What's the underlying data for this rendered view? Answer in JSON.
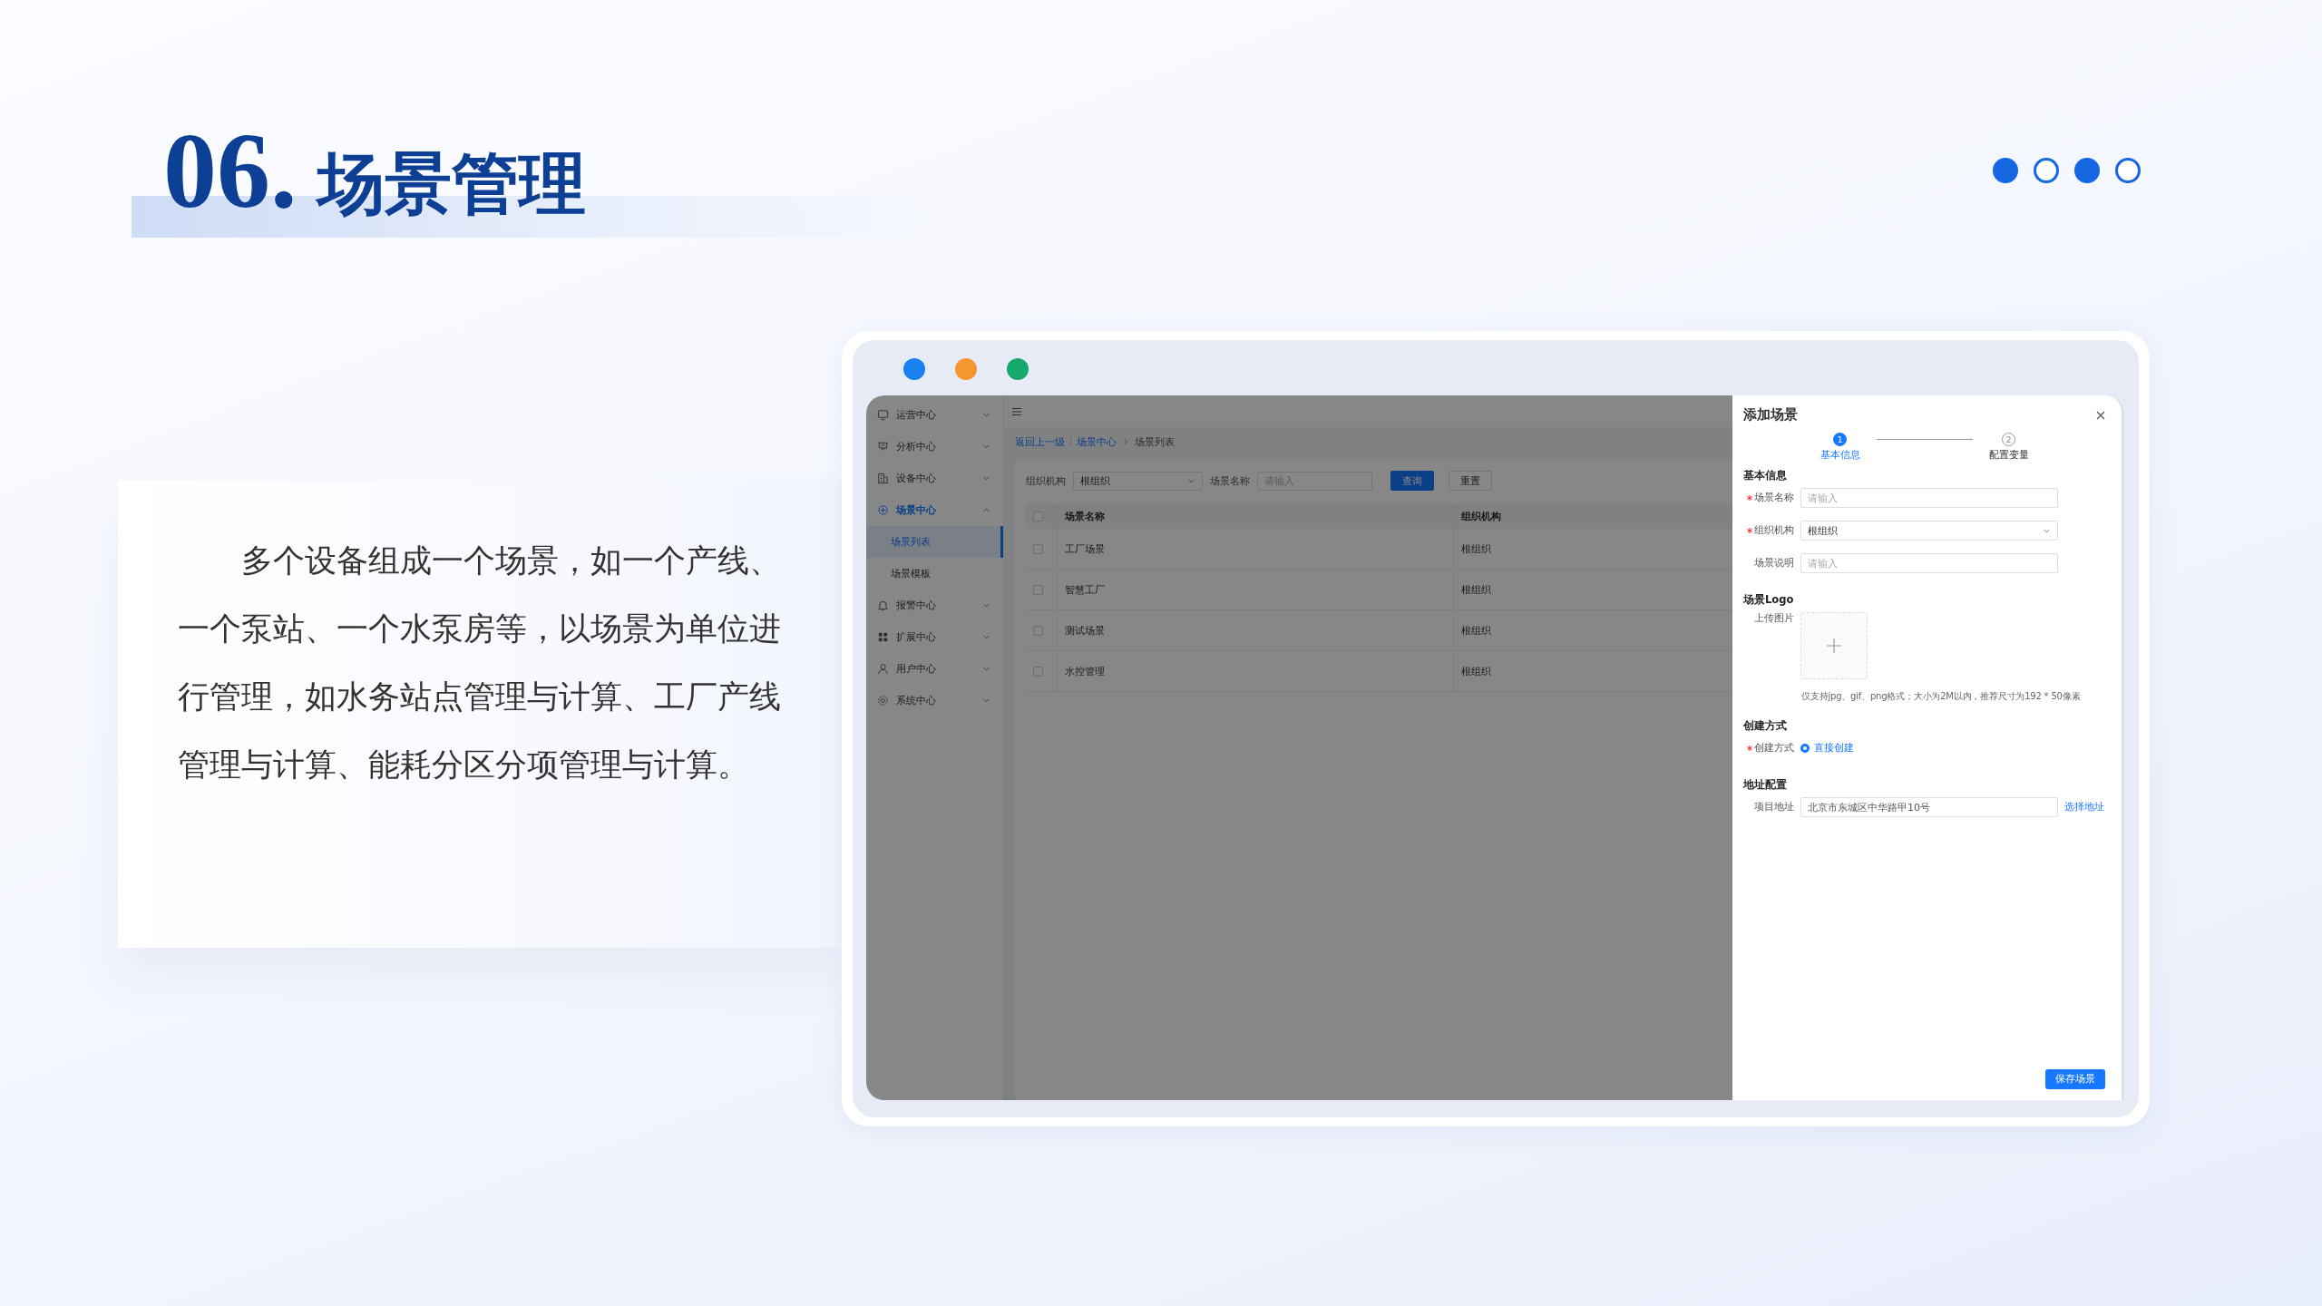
{
  "slide": {
    "number": "06.",
    "title": "场景管理",
    "pager": [
      {
        "selected": true
      },
      {
        "selected": false
      },
      {
        "selected": true
      },
      {
        "selected": false
      }
    ]
  },
  "description": "多个设备组成一个场景，如一个产线、一个泵站、一个水泵房等，以场景为单位进行管理，如水务站点管理与计算、工厂产线管理与计算、能耗分区分项管理与计算。",
  "window": {
    "controls": [
      {
        "color": "#1a7ff0"
      },
      {
        "color": "#f5962e"
      },
      {
        "color": "#17a86b"
      }
    ]
  },
  "sidebar": {
    "items": [
      {
        "label": "运营中心",
        "expanded": false,
        "selected": false
      },
      {
        "label": "分析中心",
        "expanded": false,
        "selected": false
      },
      {
        "label": "设备中心",
        "expanded": false,
        "selected": false
      },
      {
        "label": "场景中心",
        "expanded": true,
        "selected": true,
        "children": [
          {
            "label": "场景列表",
            "selected": true
          },
          {
            "label": "场景模板",
            "selected": false
          }
        ]
      },
      {
        "label": "报警中心",
        "expanded": false,
        "selected": false
      },
      {
        "label": "扩展中心",
        "expanded": false,
        "selected": false
      },
      {
        "label": "用户中心",
        "expanded": false,
        "selected": false
      },
      {
        "label": "系统中心",
        "expanded": false,
        "selected": false
      }
    ]
  },
  "breadcrumb": [
    {
      "label": "返回上一级",
      "kind": "link"
    },
    {
      "label": "场景中心",
      "kind": "link"
    },
    {
      "label": "场景列表",
      "kind": "current"
    }
  ],
  "filters": [
    {
      "label": "组织机构",
      "kind": "select",
      "value": "根组织"
    },
    {
      "label": "场景名称",
      "kind": "input",
      "placeholder": "请输入"
    }
  ],
  "filter_buttons": [
    {
      "label": "查询",
      "kind": "primary"
    },
    {
      "label": "重置",
      "kind": "default"
    }
  ],
  "table": {
    "header_checked": false,
    "columns": [
      "场景名称",
      "组织机构"
    ],
    "rows": [
      {
        "checked": false,
        "cells": [
          "工厂场景",
          "根组织"
        ]
      },
      {
        "checked": false,
        "cells": [
          "智慧工厂",
          "根组织"
        ]
      },
      {
        "checked": false,
        "cells": [
          "测试场景",
          "根组织"
        ]
      },
      {
        "checked": false,
        "cells": [
          "水控管理",
          "根组织"
        ]
      }
    ]
  },
  "drawer": {
    "title": "添加场景",
    "steps": [
      {
        "number": "1",
        "label": "基本信息",
        "selected": true
      },
      {
        "number": "2",
        "label": "配置变量",
        "selected": false
      }
    ],
    "sections": [
      {
        "title": "基本信息",
        "fields": [
          {
            "label": "场景名称",
            "required": true,
            "kind": "input",
            "placeholder": "请输入"
          },
          {
            "label": "组织机构",
            "required": true,
            "kind": "select",
            "value": "根组织"
          },
          {
            "label": "场景说明",
            "required": false,
            "kind": "input",
            "placeholder": "请输入"
          }
        ]
      },
      {
        "title": "场景Logo",
        "fields": [
          {
            "label": "上传图片",
            "required": false,
            "kind": "upload",
            "hint": "仅支持jpg、gif、png格式；大小为2M以内，推荐尺寸为192 * 50像素"
          }
        ]
      },
      {
        "title": "创建方式",
        "fields": [
          {
            "label": "创建方式",
            "required": true,
            "kind": "radio",
            "options": [
              {
                "label": "直接创建",
                "selected": true
              }
            ]
          }
        ]
      },
      {
        "title": "地址配置",
        "fields": [
          {
            "label": "项目地址",
            "required": false,
            "kind": "address",
            "value": "北京市东城区中华路甲10号",
            "action": "选择地址"
          }
        ]
      }
    ],
    "save_button": "保存场景"
  }
}
